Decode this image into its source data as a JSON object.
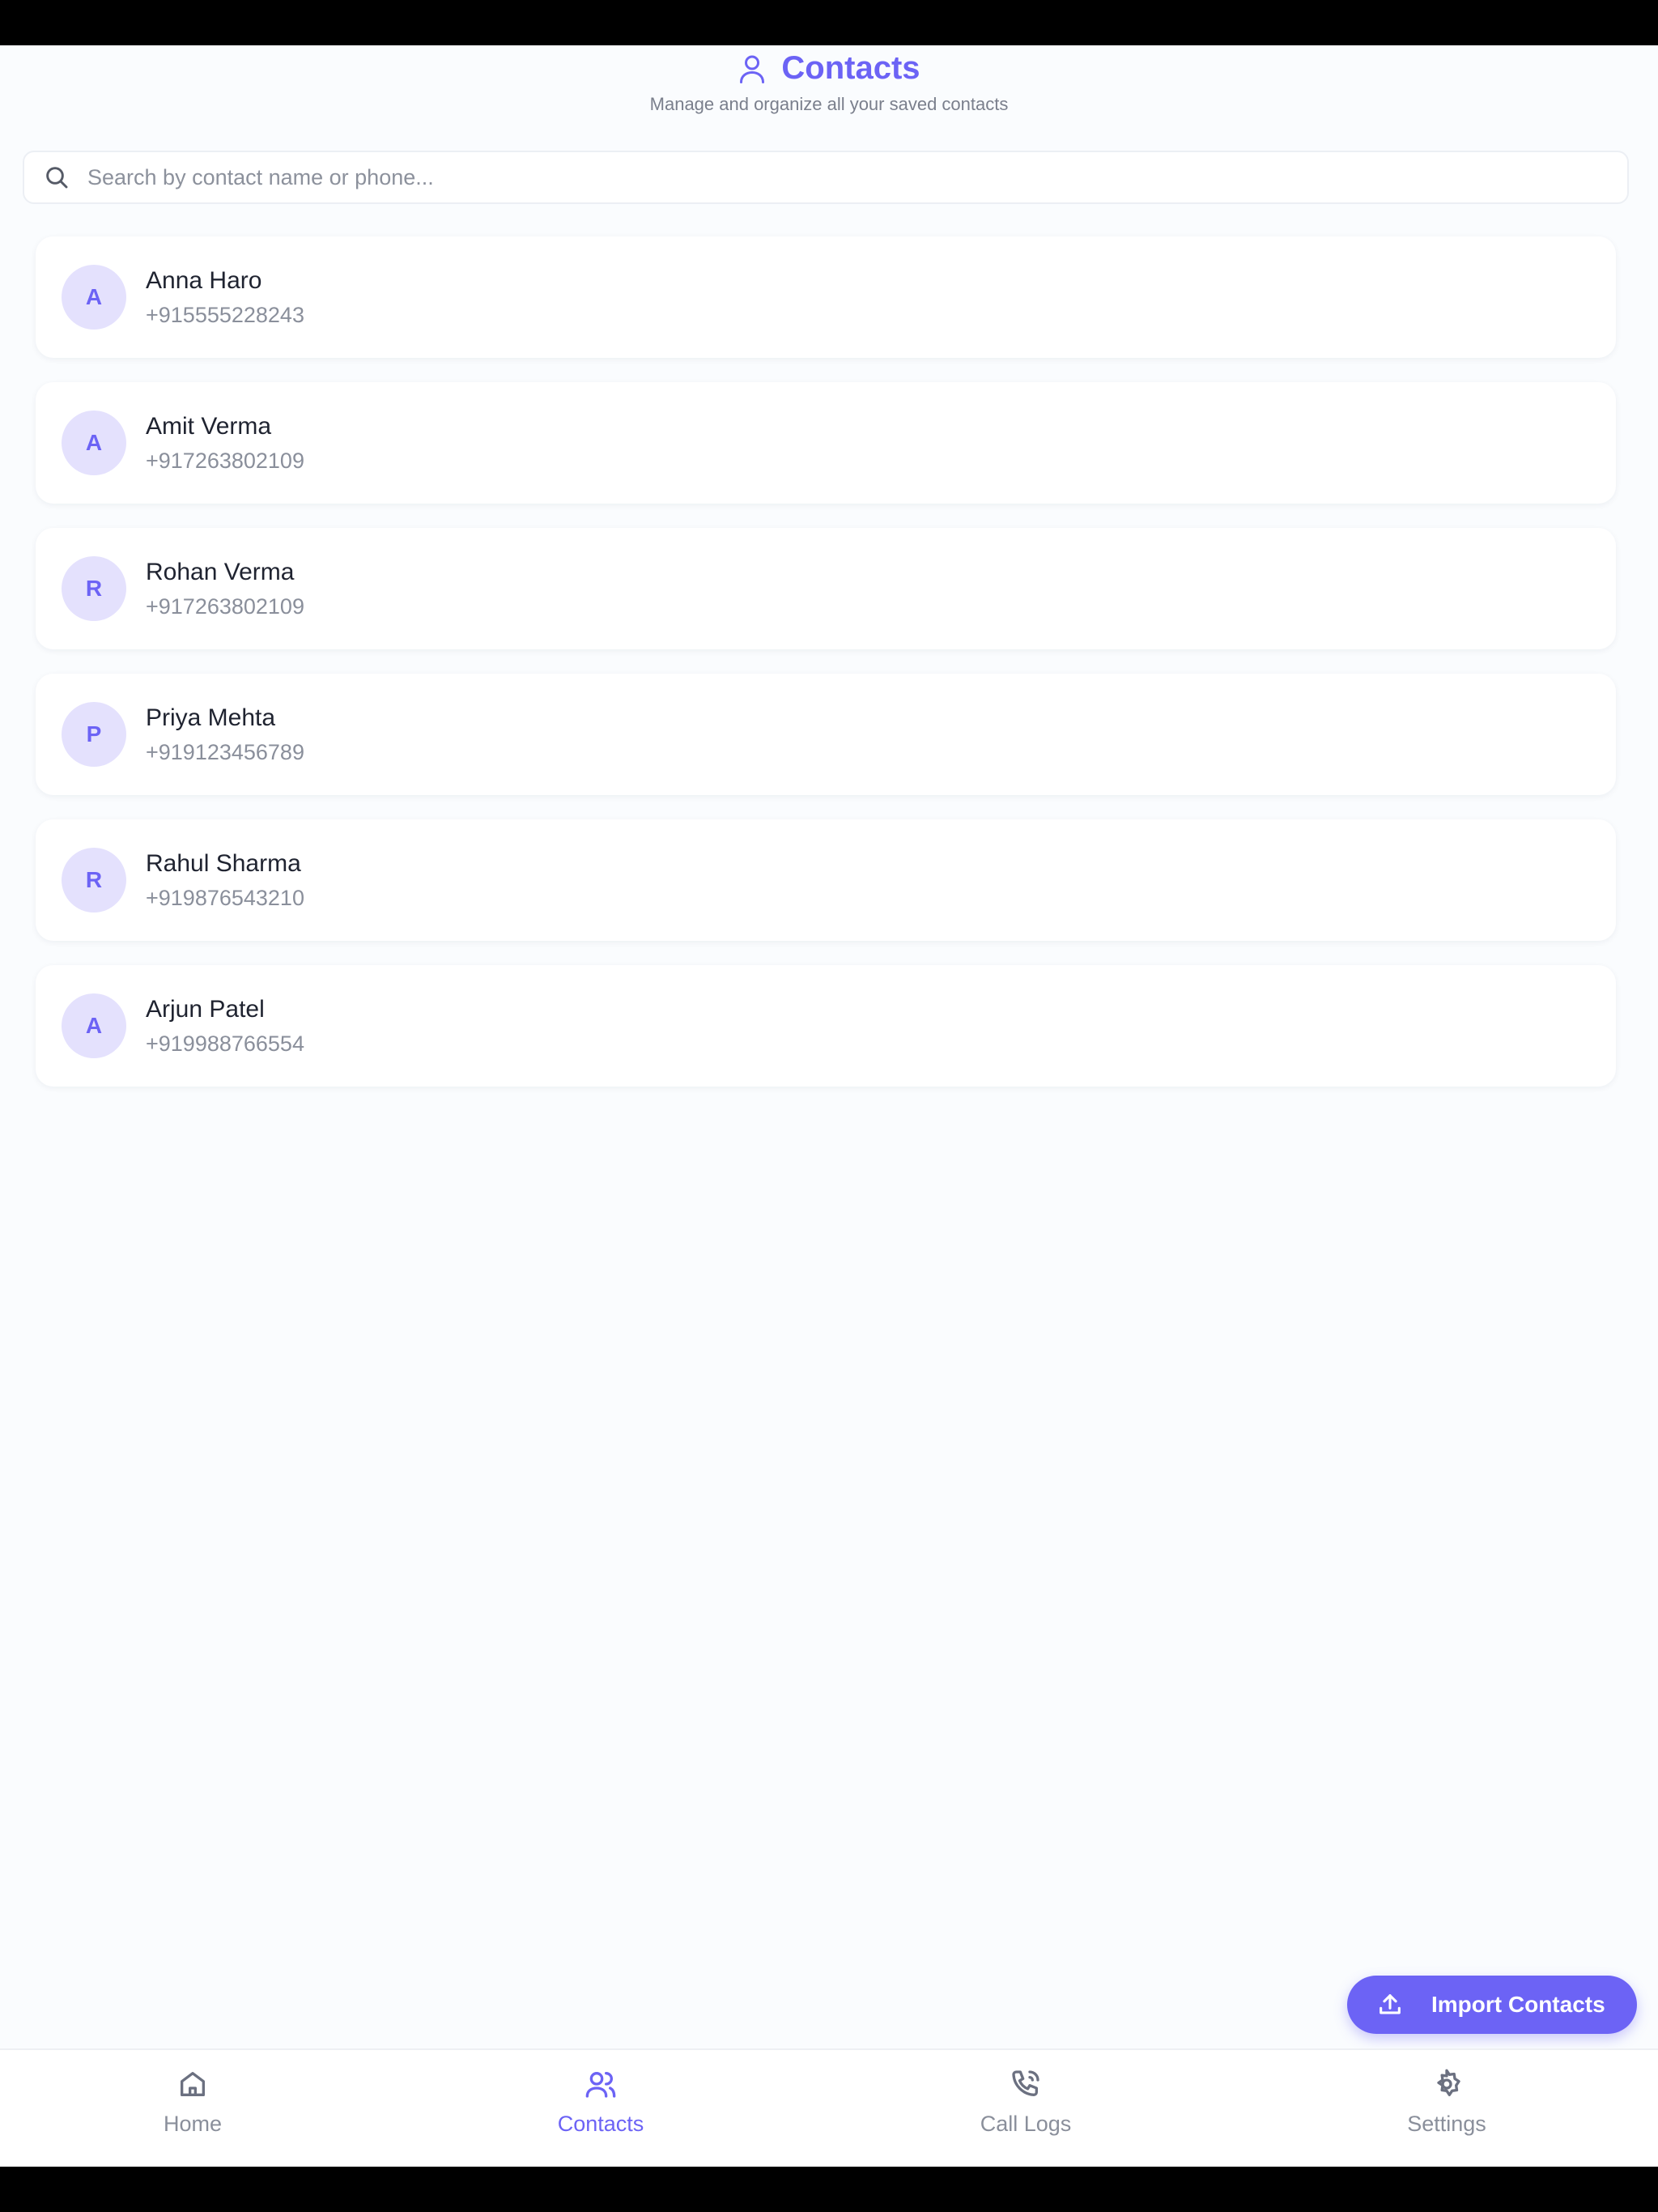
{
  "header": {
    "title": "Contacts",
    "subtitle": "Manage and organize all your saved contacts",
    "title_icon": "person-icon"
  },
  "search": {
    "placeholder": "Search by contact name or phone...",
    "value": ""
  },
  "contacts": [
    {
      "initial": "A",
      "name": "Anna Haro",
      "phone": "+915555228243"
    },
    {
      "initial": "A",
      "name": "Amit Verma",
      "phone": "+917263802109"
    },
    {
      "initial": "R",
      "name": "Rohan Verma",
      "phone": "+917263802109"
    },
    {
      "initial": "P",
      "name": "Priya Mehta",
      "phone": "+919123456789"
    },
    {
      "initial": "R",
      "name": "Rahul Sharma",
      "phone": "+919876543210"
    },
    {
      "initial": "A",
      "name": "Arjun Patel",
      "phone": "+919988766554"
    }
  ],
  "import_button": {
    "label": "Import Contacts",
    "icon": "upload-icon"
  },
  "bottom_nav": {
    "items": [
      {
        "label": "Home",
        "icon": "home-icon",
        "active": false
      },
      {
        "label": "Contacts",
        "icon": "contacts-icon",
        "active": true
      },
      {
        "label": "Call Logs",
        "icon": "phone-call-icon",
        "active": false
      },
      {
        "label": "Settings",
        "icon": "gear-icon",
        "active": false
      }
    ]
  },
  "colors": {
    "accent": "#6c63f5",
    "avatar_bg": "#e4e1fd",
    "background": "#fafcfe",
    "muted_text": "#8a8f9b"
  }
}
